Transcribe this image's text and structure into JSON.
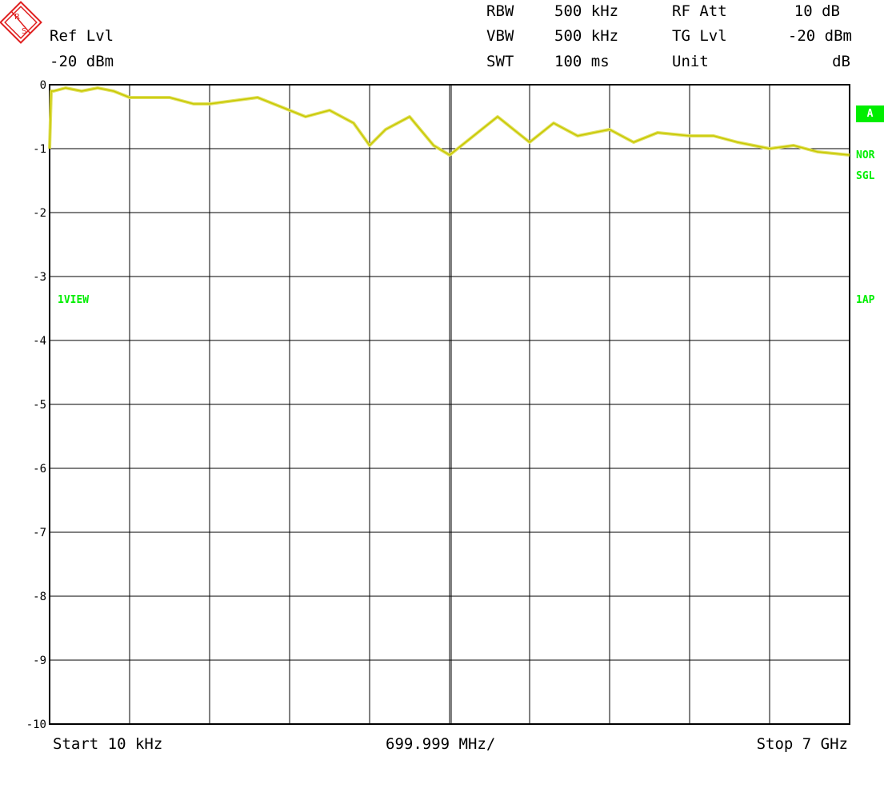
{
  "header": {
    "ref_label": "Ref Lvl",
    "ref_value": "-20 dBm",
    "rbw_label": "RBW",
    "rbw_value": "500 kHz",
    "vbw_label": "VBW",
    "vbw_value": "500 kHz",
    "swt_label": "SWT",
    "swt_value": "100 ms",
    "rfatt_label": "RF Att",
    "rfatt_value": "10 dB",
    "tglvl_label": "TG Lvl",
    "tglvl_value": "-20 dBm",
    "unit_label": "Unit",
    "unit_value": "dB"
  },
  "side": {
    "trace_mode": "1VIEW",
    "badge": "A",
    "nor": "NOR",
    "sgl": "SGL",
    "detector": "1AP"
  },
  "footer": {
    "start": "Start 10 kHz",
    "span_per_div": "699.999 MHz/",
    "stop": "Stop 7 GHz"
  },
  "colors": {
    "trace": "#c8c800",
    "trace_fill": "#e0e060",
    "label_green": "#00ee00",
    "logo_red": "#e02020"
  },
  "chart_data": {
    "type": "line",
    "ylim": [
      -10,
      0
    ],
    "xlim": [
      0,
      10
    ],
    "y_ticks": [
      "0",
      "-1",
      "-2",
      "-3",
      "-4",
      "-5",
      "-6",
      "-7",
      "-8",
      "-9",
      "-10"
    ],
    "grid": true,
    "series": [
      {
        "x": [
          0,
          0.02,
          0.05,
          0.2,
          0.4,
          0.6,
          0.8,
          1.0,
          1.2,
          1.5,
          1.8,
          2.0,
          2.3,
          2.6,
          3.0,
          3.2,
          3.5,
          3.8,
          4.0,
          4.2,
          4.5,
          4.8,
          5.0,
          5.3,
          5.6,
          6.0,
          6.3,
          6.6,
          7.0,
          7.3,
          7.6,
          8.0,
          8.3,
          8.6,
          9.0,
          9.3,
          9.6,
          10.0
        ],
        "y": [
          -1.0,
          -0.1,
          -0.1,
          -0.05,
          -0.1,
          -0.05,
          -0.1,
          -0.2,
          -0.2,
          -0.2,
          -0.3,
          -0.3,
          -0.25,
          -0.2,
          -0.4,
          -0.5,
          -0.4,
          -0.6,
          -0.95,
          -0.7,
          -0.5,
          -0.95,
          -1.1,
          -0.8,
          -0.5,
          -0.9,
          -0.6,
          -0.8,
          -0.7,
          -0.9,
          -0.75,
          -0.8,
          -0.8,
          -0.9,
          -1.0,
          -0.95,
          -1.05,
          -1.1
        ]
      }
    ]
  }
}
